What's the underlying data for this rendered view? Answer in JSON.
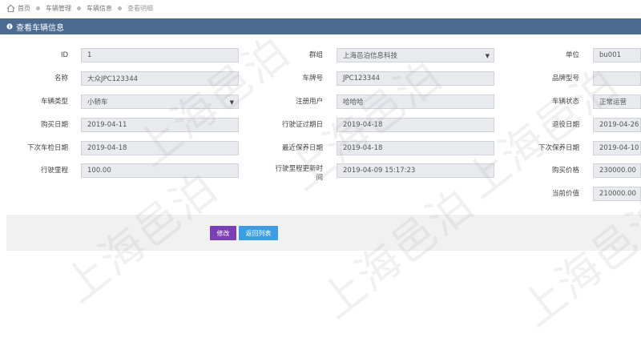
{
  "breadcrumb": {
    "items": [
      "首页",
      "车辆管理",
      "车辆信息",
      "查看明细"
    ]
  },
  "panel": {
    "title": "查看车辆信息"
  },
  "fields": {
    "id": {
      "label": "ID",
      "value": "1"
    },
    "group": {
      "label": "群组",
      "value": "上海邑泊信息科技"
    },
    "unit": {
      "label": "单位",
      "value": "bu001"
    },
    "name": {
      "label": "名称",
      "value": "大众JPC123344"
    },
    "plate": {
      "label": "车牌号",
      "value": "JPC123344"
    },
    "brand_model": {
      "label": "品牌型号",
      "value": ""
    },
    "vehicle_type": {
      "label": "车辆类型",
      "value": "小轿车"
    },
    "reg_user": {
      "label": "注册用户",
      "value": "哈哈哈"
    },
    "vehicle_status": {
      "label": "车辆状态",
      "value": "正常运营"
    },
    "purchase_date": {
      "label": "购买日期",
      "value": "2019-04-11"
    },
    "pass_expiry": {
      "label": "行驶证过期日",
      "value": "2019-04-18"
    },
    "retire_date": {
      "label": "退役日期",
      "value": "2019-04-26"
    },
    "next_inspection": {
      "label": "下次车检日期",
      "value": "2019-04-18"
    },
    "last_maintenance": {
      "label": "最近保养日期",
      "value": "2019-04-18"
    },
    "next_maintenance": {
      "label": "下次保养日期",
      "value": "2019-04-10"
    },
    "mileage": {
      "label": "行驶里程",
      "value": "100.00"
    },
    "mileage_updated": {
      "label": "行驶里程更新时间",
      "value": "2019-04-09 15:17:23"
    },
    "purchase_price": {
      "label": "购买价格",
      "value": "230000.00"
    },
    "current_value": {
      "label": "当前价值",
      "value": "210000.00"
    }
  },
  "buttons": {
    "edit": "修改",
    "back": "返回列表"
  },
  "watermark": "上海邑泊",
  "colors": {
    "header_bg": "#4a6a90",
    "edit_button": "#7a3fb3",
    "back_button": "#3d9de0",
    "input_bg": "#e8eaee"
  }
}
